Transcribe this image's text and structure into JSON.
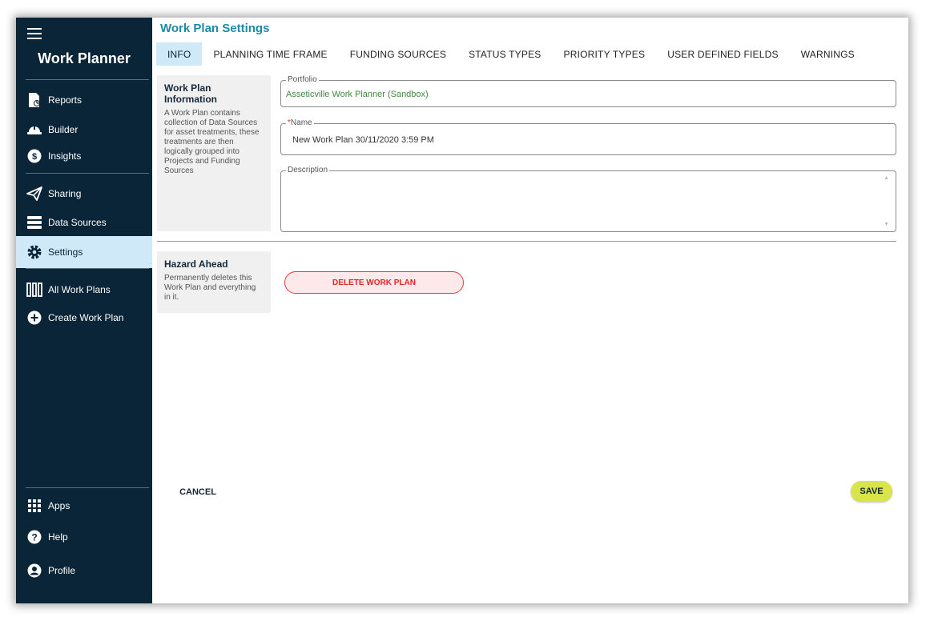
{
  "app": {
    "title": "Work Planner"
  },
  "sidebar": {
    "items": [
      {
        "label": "Reports",
        "icon": "report-icon"
      },
      {
        "label": "Builder",
        "icon": "hardhat-icon"
      },
      {
        "label": "Insights",
        "icon": "dollar-icon"
      },
      {
        "label": "Sharing",
        "icon": "send-icon"
      },
      {
        "label": "Data Sources",
        "icon": "database-icon"
      },
      {
        "label": "Settings",
        "icon": "gear-icon",
        "active": true
      },
      {
        "label": "All Work Plans",
        "icon": "columns-icon"
      },
      {
        "label": "Create Work Plan",
        "icon": "plus-circle-icon"
      },
      {
        "label": "Apps",
        "icon": "grid-icon"
      },
      {
        "label": "Help",
        "icon": "help-icon"
      },
      {
        "label": "Profile",
        "icon": "user-icon"
      }
    ]
  },
  "page": {
    "title": "Work Plan Settings"
  },
  "tabs": [
    {
      "label": "INFO",
      "active": true
    },
    {
      "label": "PLANNING TIME FRAME"
    },
    {
      "label": "FUNDING SOURCES"
    },
    {
      "label": "STATUS TYPES"
    },
    {
      "label": "PRIORITY TYPES"
    },
    {
      "label": "USER DEFINED FIELDS"
    },
    {
      "label": "WARNINGS"
    }
  ],
  "info_section": {
    "heading": "Work Plan Information",
    "description": "A Work Plan contains collection of Data Sources for asset treatments, these treatments are then logically grouped into Projects and Funding Sources"
  },
  "form": {
    "portfolio": {
      "label": "Portfolio",
      "value": "Asseticville Work Planner (Sandbox)"
    },
    "name": {
      "required_mark": "*",
      "label": "Name",
      "value": "New Work Plan 30/11/2020 3:59 PM"
    },
    "description": {
      "label": "Description",
      "value": ""
    }
  },
  "hazard_section": {
    "heading": "Hazard Ahead",
    "description": "Permanently deletes this Work Plan and everything in it."
  },
  "buttons": {
    "delete": "DELETE WORK PLAN",
    "cancel": "CANCEL",
    "save": "SAVE"
  },
  "colors": {
    "sidebar_bg": "#0b2538",
    "accent": "#1c8aa6",
    "active_bg": "#cfe9f8",
    "danger": "#e02525",
    "save_bg": "#d8e44a",
    "portfolio_text": "#3f8a3f"
  }
}
